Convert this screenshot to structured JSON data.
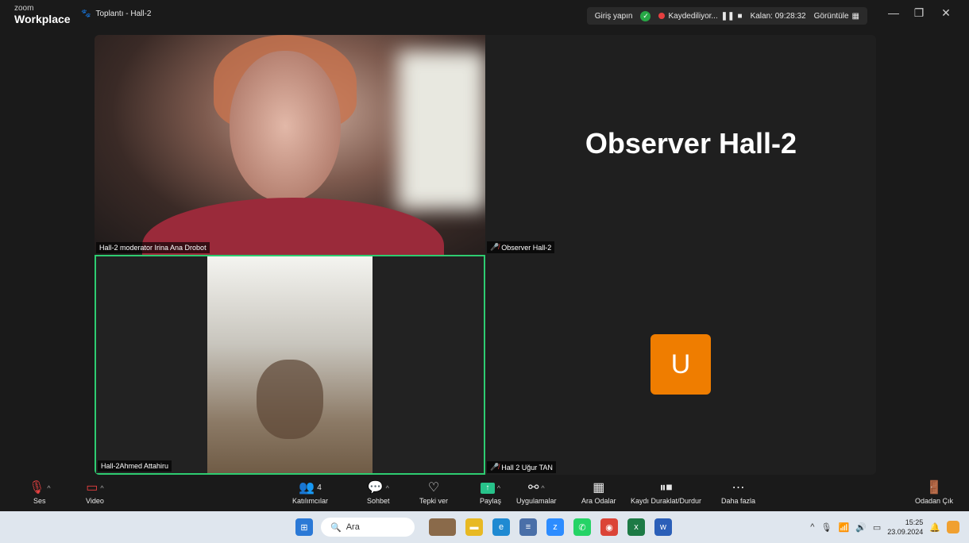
{
  "app": {
    "brand_small": "zoom",
    "brand_big": "Workplace",
    "meeting_title": "Toplantı - Hall-2"
  },
  "topbar": {
    "signin": "Giriş yapın",
    "recording": "Kaydediliyor...",
    "remaining": "Kalan: 09:28:32",
    "view": "Görüntüle"
  },
  "window": {
    "minimize": "—",
    "restore": "❐",
    "close": "✕"
  },
  "tiles": {
    "t1_name": "Hall-2 moderator Irina Ana Drobot",
    "t2_name": "Observer Hall-2",
    "t2_big": "Observer Hall-2",
    "t3_name": "Hall-2Ahmed Attahiru",
    "t4_name": "Hall 2 Uğur TAN",
    "t4_initial": "U"
  },
  "toolbar": {
    "audio": "Ses",
    "video": "Video",
    "participants": "Katılımcılar",
    "participants_count": "4",
    "chat": "Sohbet",
    "react": "Tepki ver",
    "share": "Paylaş",
    "apps": "Uygulamalar",
    "breakout": "Ara Odalar",
    "record": "Kaydı Duraklat/Durdur",
    "more": "Daha fazla",
    "leave": "Odadan Çık"
  },
  "taskbar": {
    "search": "Ara",
    "time": "15:25",
    "date": "23.09.2024"
  },
  "colors": {
    "active_border": "#2ecc71",
    "avatar_bg": "#ef7d00",
    "share_green": "#27c28a",
    "rec_red": "#e64040"
  }
}
